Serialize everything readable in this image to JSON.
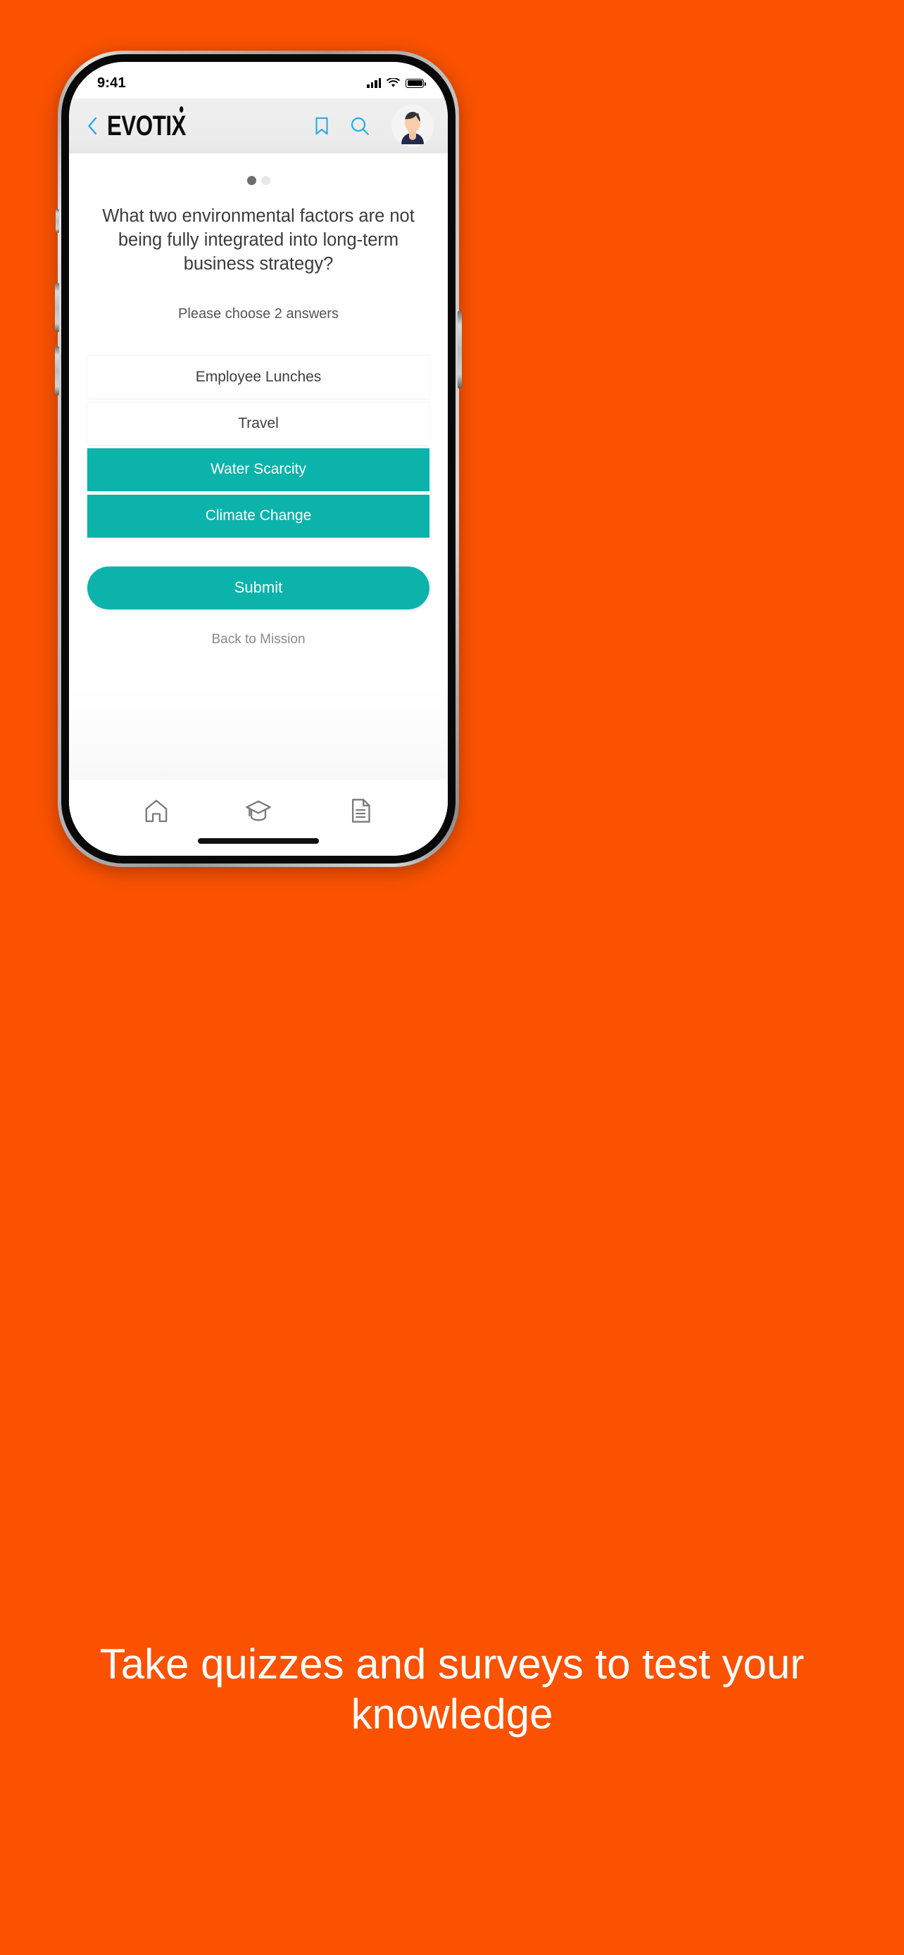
{
  "theme": {
    "background_orange": "#FA5200",
    "accent_teal": "#0CB3AB",
    "icon_blue": "#29ABE2",
    "text_dark": "#3b3b3b",
    "text_muted": "#8a8a8a"
  },
  "status_bar": {
    "time": "9:41",
    "signal_icon": "cellular-signal-icon",
    "wifi_icon": "wifi-icon",
    "battery_icon": "battery-full-icon"
  },
  "header": {
    "back_icon": "chevron-left-icon",
    "brand": "EVOTIX",
    "bookmark_icon": "bookmark-icon",
    "search_icon": "search-icon",
    "avatar_icon": "user-avatar"
  },
  "pager": {
    "total": 2,
    "active_index": 0
  },
  "quiz": {
    "question": "What two environmental factors are not being fully integrated into long-term business strategy?",
    "hint": "Please choose 2 answers",
    "options": [
      {
        "label": "Employee Lunches",
        "selected": false
      },
      {
        "label": "Travel",
        "selected": false
      },
      {
        "label": "Water Scarcity",
        "selected": true
      },
      {
        "label": "Climate Change",
        "selected": true
      }
    ],
    "submit_label": "Submit",
    "back_link_label": "Back to Mission"
  },
  "bottom_nav": {
    "items": [
      {
        "icon": "home-icon",
        "name": "nav-home"
      },
      {
        "icon": "graduation-cap-icon",
        "name": "nav-learning"
      },
      {
        "icon": "document-icon",
        "name": "nav-documents"
      }
    ]
  },
  "caption": {
    "text": "Take quizzes and surveys to test your knowledge"
  }
}
